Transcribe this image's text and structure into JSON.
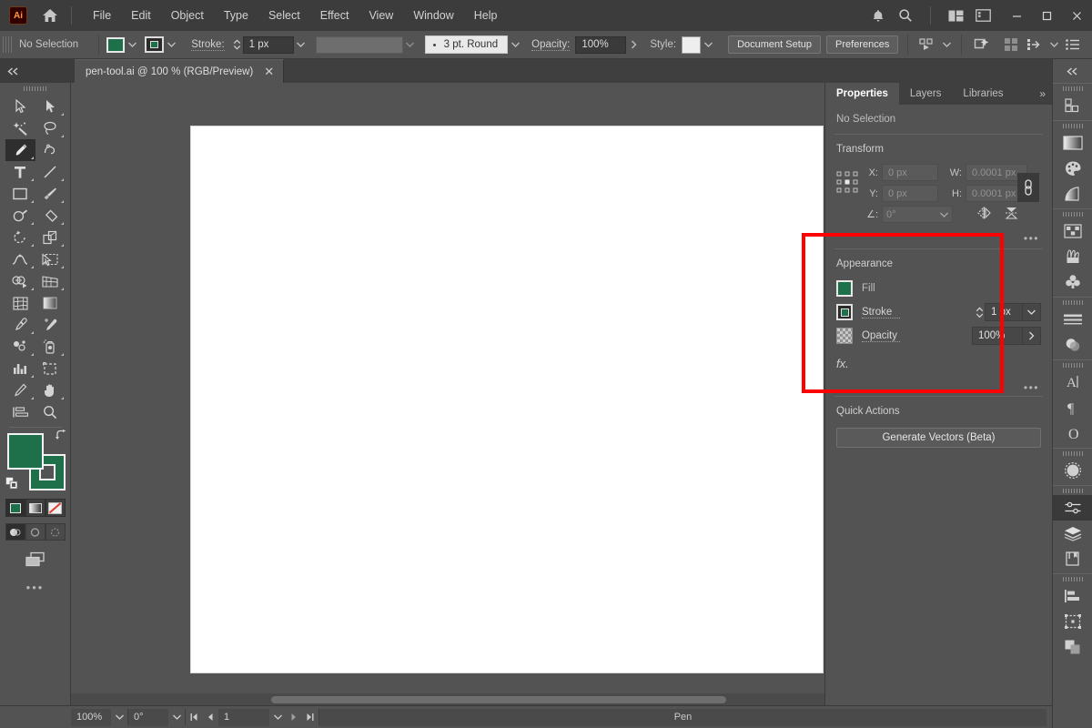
{
  "app": {
    "logo": "Ai",
    "name": "Adobe Illustrator"
  },
  "menubar": {
    "home_icon": "home-icon",
    "items": [
      "File",
      "Edit",
      "Object",
      "Type",
      "Select",
      "Effect",
      "View",
      "Window",
      "Help"
    ],
    "right_icons": [
      "bell-icon",
      "search-icon",
      "workspace-switcher-icon",
      "panel-layout-icon"
    ],
    "window_controls": {
      "minimize": "—",
      "maximize": "☐",
      "close": "✕"
    }
  },
  "controlbar": {
    "selection_status": "No Selection",
    "fill_swatch_color": "#1d7049",
    "stroke_swatch_color": "#1d7049",
    "stroke_label": "Stroke:",
    "stroke_weight": "1 px",
    "variable_width_placeholder": "",
    "brush_definition": "3 pt. Round",
    "opacity_label": "Opacity:",
    "opacity_value": "100%",
    "style_label": "Style:",
    "document_setup": "Document Setup",
    "preferences": "Preferences",
    "right_icons": [
      "select-similar-icon",
      "recolor-artwork-icon",
      "arrange-grid-icon",
      "align-icon",
      "options-menu-icon"
    ]
  },
  "tabbar": {
    "document_title": "pen-tool.ai @ 100 % (RGB/Preview)",
    "close_glyph": "✕"
  },
  "toolbar": {
    "active_tool": "pen-tool",
    "tools": [
      {
        "name": "selection-tool",
        "glyph": "selection"
      },
      {
        "name": "direct-selection-tool",
        "glyph": "direct-selection"
      },
      {
        "name": "magic-wand-tool",
        "glyph": "wand"
      },
      {
        "name": "lasso-tool",
        "glyph": "lasso"
      },
      {
        "name": "pen-tool",
        "glyph": "pen",
        "active": true
      },
      {
        "name": "curvature-tool",
        "glyph": "curvature"
      },
      {
        "name": "type-tool",
        "glyph": "type"
      },
      {
        "name": "line-segment-tool",
        "glyph": "line"
      },
      {
        "name": "rectangle-tool",
        "glyph": "rect"
      },
      {
        "name": "paintbrush-tool",
        "glyph": "brush"
      },
      {
        "name": "shaper-tool",
        "glyph": "shaper"
      },
      {
        "name": "eraser-tool",
        "glyph": "eraser"
      },
      {
        "name": "rotate-tool",
        "glyph": "rotate"
      },
      {
        "name": "scale-tool",
        "glyph": "scale"
      },
      {
        "name": "width-tool",
        "glyph": "width"
      },
      {
        "name": "free-transform-tool",
        "glyph": "free-transform"
      },
      {
        "name": "shape-builder-tool",
        "glyph": "shape-builder"
      },
      {
        "name": "perspective-grid-tool",
        "glyph": "perspective"
      },
      {
        "name": "mesh-tool",
        "glyph": "mesh"
      },
      {
        "name": "gradient-tool",
        "glyph": "gradient"
      },
      {
        "name": "eyedropper-tool",
        "glyph": "eyedropper"
      },
      {
        "name": "blend-tool",
        "glyph": "blend"
      },
      {
        "name": "symbol-sprayer-tool",
        "glyph": "symbol-sprayer"
      },
      {
        "name": "column-graph-tool",
        "glyph": "graph"
      },
      {
        "name": "artboard-tool",
        "glyph": "artboard"
      },
      {
        "name": "slice-tool",
        "glyph": "slice"
      },
      {
        "name": "hand-tool",
        "glyph": "hand"
      },
      {
        "name": "zoom-tool",
        "glyph": "zoom"
      }
    ],
    "fill_color": "#1d7049",
    "stroke_color": "#1d7049",
    "color_modes": [
      "color-swatch-mode",
      "gradient-mode",
      "none-mode"
    ],
    "drawing_modes": [
      "draw-normal",
      "draw-behind",
      "draw-inside"
    ],
    "more_glyph": "•••"
  },
  "canvas": {
    "artboard_background": "#ffffff"
  },
  "statusbar": {
    "zoom_level": "100%",
    "rotation": "0°",
    "page_number": "1",
    "current_tool": "Pen"
  },
  "properties": {
    "tabs": [
      {
        "label": "Properties",
        "active": true
      },
      {
        "label": "Layers",
        "active": false
      },
      {
        "label": "Libraries",
        "active": false
      }
    ],
    "overflow_glyph": "»",
    "selection_state": "No Selection",
    "transform": {
      "title": "Transform",
      "x_label": "X:",
      "x_value": "0 px",
      "y_label": "Y:",
      "y_value": "0 px",
      "w_label": "W:",
      "w_value": "0.0001 px",
      "h_label": "H:",
      "h_value": "0.0001 px",
      "angle_label": "∠:",
      "angle_value": "0°",
      "link_icon": "link-wh-icon",
      "flip_horizontal_icon": "flip-horizontal-icon",
      "flip_vertical_icon": "flip-vertical-icon",
      "more_glyph": "•••"
    },
    "appearance": {
      "title": "Appearance",
      "fill_label": "Fill",
      "fill_color": "#1d7049",
      "stroke_label": "Stroke",
      "stroke_color": "#1d7049",
      "stroke_weight": "1 px",
      "opacity_label": "Opacity",
      "opacity_value": "100%",
      "fx_label": "fx.",
      "more_glyph": "•••"
    },
    "quick_actions": {
      "title": "Quick Actions",
      "generate_vectors": "Generate Vectors (Beta)"
    }
  },
  "highlight": {
    "color": "#ff0000",
    "target": "appearance-section"
  },
  "dock": {
    "collapse_glyph": "«",
    "groups": [
      {
        "icons": [
          {
            "name": "asset-export-icon"
          }
        ]
      },
      {
        "icons": [
          {
            "name": "gradient-panel-icon"
          },
          {
            "name": "color-panel-icon"
          },
          {
            "name": "color-guide-icon"
          }
        ]
      },
      {
        "icons": [
          {
            "name": "swatches-panel-icon"
          },
          {
            "name": "brushes-panel-icon"
          },
          {
            "name": "symbols-panel-icon"
          }
        ]
      },
      {
        "icons": [
          {
            "name": "stroke-panel-icon"
          },
          {
            "name": "transparency-panel-icon"
          }
        ]
      },
      {
        "icons": [
          {
            "name": "character-panel-icon"
          },
          {
            "name": "paragraph-panel-icon"
          },
          {
            "name": "glyphs-panel-icon"
          }
        ]
      },
      {
        "icons": [
          {
            "name": "image-trace-icon"
          }
        ]
      },
      {
        "icons": [
          {
            "name": "properties-panel-icon",
            "selected": true
          },
          {
            "name": "layers-panel-icon"
          },
          {
            "name": "libraries-panel-icon"
          }
        ]
      },
      {
        "icons": [
          {
            "name": "align-panel-icon"
          },
          {
            "name": "transform-panel-icon"
          },
          {
            "name": "pathfinder-panel-icon"
          }
        ]
      }
    ]
  }
}
